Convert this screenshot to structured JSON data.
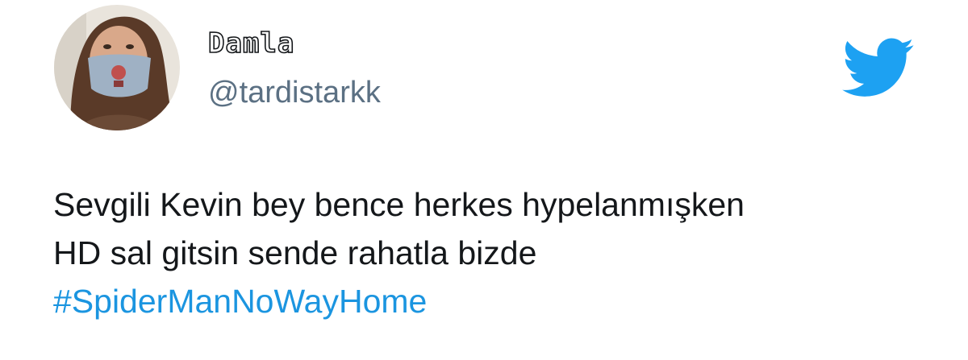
{
  "tweet": {
    "author": {
      "display_name": "Damla",
      "handle": "@tardistarkk"
    },
    "text_lines": [
      "Sevgili Kevin bey bence herkes hypelanmışken",
      "HD sal gitsin sende rahatla bizde"
    ],
    "hashtag": "#SpiderManNoWayHome"
  },
  "icons": {
    "platform": "twitter-bird-icon"
  },
  "colors": {
    "brand": "#1da1f2",
    "hashtag": "#1b95e0",
    "handle": "#5b7083",
    "text": "#14171a"
  }
}
